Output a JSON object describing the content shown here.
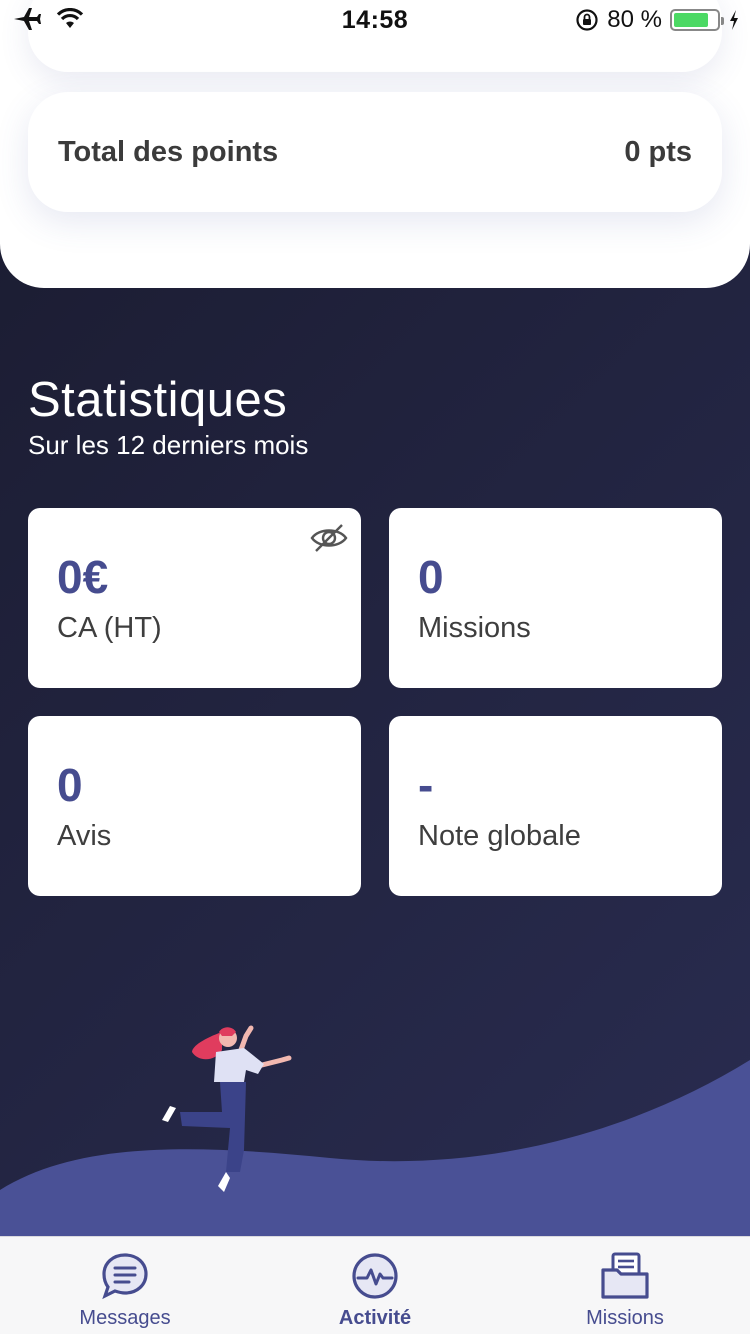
{
  "status_bar": {
    "time": "14:58",
    "battery_text": "80 %",
    "battery_level": 0.8,
    "icons": [
      "airplane-icon",
      "wifi-icon",
      "orientation-lock-icon",
      "battery-icon",
      "charging-icon"
    ]
  },
  "points": {
    "label": "Total des points",
    "value": "0 pts"
  },
  "stats": {
    "title": "Statistiques",
    "subtitle": "Sur les 12 derniers mois",
    "cards": [
      {
        "value": "0€",
        "label": "CA (HT)",
        "icon": "eye-slash-icon"
      },
      {
        "value": "0",
        "label": "Missions"
      },
      {
        "value": "0",
        "label": "Avis"
      },
      {
        "value": "-",
        "label": "Note globale"
      }
    ]
  },
  "tabs": [
    {
      "label": "Messages",
      "icon": "chat-bubble-icon",
      "active": false
    },
    {
      "label": "Activité",
      "icon": "activity-pulse-icon",
      "active": true
    },
    {
      "label": "Missions",
      "icon": "folder-icon",
      "active": false
    }
  ],
  "colors": {
    "accent": "#464c8f",
    "background_dark": "#1f2140",
    "hill": "#4a5196",
    "battery": "#4cd964"
  }
}
